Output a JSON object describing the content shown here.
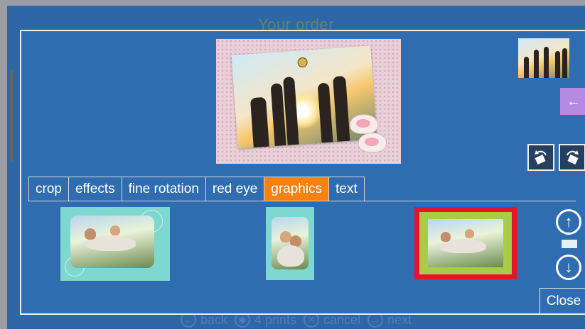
{
  "app": {
    "title": "Your order"
  },
  "bottom_nav": {
    "back_label": "back",
    "prints_label": "4 prints",
    "cancel_label": "cancel",
    "next_label": "next"
  },
  "tabs": [
    {
      "label": "crop"
    },
    {
      "label": "effects"
    },
    {
      "label": "fine rotation"
    },
    {
      "label": "red eye"
    },
    {
      "label": "graphics",
      "active": true
    },
    {
      "label": "text"
    }
  ],
  "buttons": {
    "close_label": "Close"
  },
  "colors": {
    "background": "#2e67a8",
    "active_tab": "#f7820f",
    "back_button": "#b48be0",
    "selected_frame": "#e0162b"
  },
  "icons": {
    "back": "arrow-left-icon",
    "rotate_left": "rotate-left-icon",
    "rotate_right": "rotate-right-icon",
    "scroll_up": "arrow-up-circle-icon",
    "scroll_down": "arrow-down-circle-icon"
  },
  "graphics_options": [
    {
      "name": "aqua-floral-frame-landscape",
      "selected": false
    },
    {
      "name": "aqua-floral-frame-portrait",
      "selected": false
    },
    {
      "name": "red-green-sketch-frame",
      "selected": true
    }
  ]
}
